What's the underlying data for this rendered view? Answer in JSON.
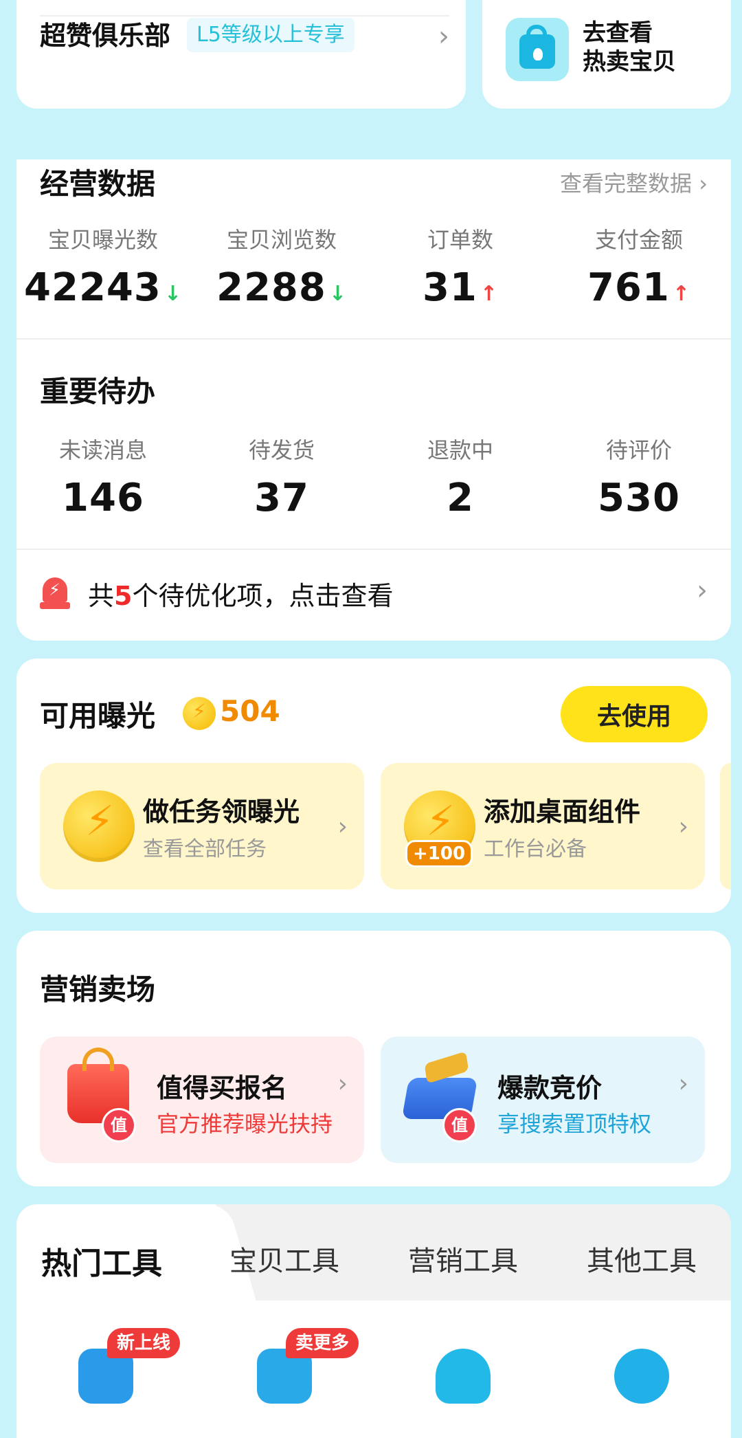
{
  "club": {
    "title": "超赞俱乐部",
    "tag": "L5等级以上专享"
  },
  "hot": {
    "line1": "去查看",
    "line2": "热卖宝贝"
  },
  "business": {
    "title": "经营数据",
    "more": "查看完整数据 ›",
    "stats": [
      {
        "label": "宝贝曝光数",
        "value": "42243",
        "trend": "down"
      },
      {
        "label": "宝贝浏览数",
        "value": "2288",
        "trend": "down"
      },
      {
        "label": "订单数",
        "value": "31",
        "trend": "up"
      },
      {
        "label": "支付金额",
        "value": "761",
        "trend": "up"
      }
    ]
  },
  "todo": {
    "title": "重要待办",
    "items": [
      {
        "label": "未读消息",
        "value": "146"
      },
      {
        "label": "待发货",
        "value": "37"
      },
      {
        "label": "退款中",
        "value": "2"
      },
      {
        "label": "待评价",
        "value": "530"
      }
    ],
    "optimize_prefix": "共",
    "optimize_count": "5",
    "optimize_suffix": "个待优化项，点击查看"
  },
  "exposure": {
    "title": "可用曝光",
    "amount": "504",
    "use_button": "去使用",
    "tasks": [
      {
        "title": "做任务领曝光",
        "subtitle": "查看全部任务",
        "badge": ""
      },
      {
        "title": "添加桌面组件",
        "subtitle": "工作台必备",
        "badge": "+100"
      }
    ]
  },
  "marketing": {
    "title": "营销卖场",
    "cards": [
      {
        "title": "值得买报名",
        "subtitle": "官方推荐曝光扶持",
        "badge": "值"
      },
      {
        "title": "爆款竞价",
        "subtitle": "享搜索置顶特权",
        "badge": "值"
      }
    ]
  },
  "tools": {
    "tabs": [
      "热门工具",
      "宝贝工具",
      "营销工具",
      "其他工具"
    ],
    "ribbons": [
      "新上线",
      "卖更多"
    ]
  },
  "colors": {
    "background": "#c9f3fb",
    "accent_yellow": "#ffe219",
    "trend_up": "#ef4444",
    "trend_down": "#2bc463",
    "exposure_amount": "#f08a00"
  }
}
